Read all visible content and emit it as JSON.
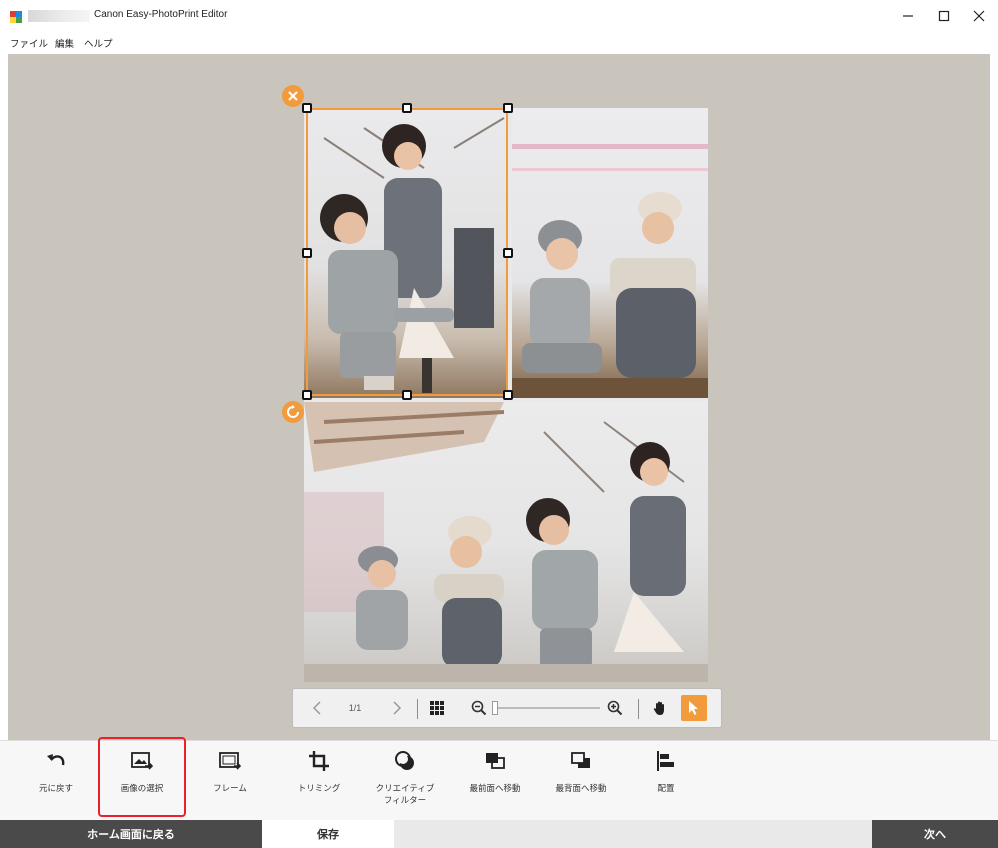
{
  "window": {
    "title": "Canon Easy-PhotoPrint Editor",
    "controls": {
      "minimize": "minimize-icon",
      "maximize": "maximize-icon",
      "close": "close-icon"
    }
  },
  "menu": [
    {
      "label": "ファイル"
    },
    {
      "label": "編集"
    },
    {
      "label": "ヘルプ"
    }
  ],
  "page_nav": {
    "page_indicator": "1/1"
  },
  "toolbar": [
    {
      "label": "元に戻す",
      "icon": "undo-icon"
    },
    {
      "label": "画像の選択",
      "icon": "select-image-icon"
    },
    {
      "label": "フレーム",
      "icon": "frame-icon"
    },
    {
      "label": "トリミング",
      "icon": "crop-icon"
    },
    {
      "label": "クリエイティブ\nフィルター",
      "icon": "creative-filter-icon"
    },
    {
      "label": "最前面へ移動",
      "icon": "bring-to-front-icon"
    },
    {
      "label": "最背面へ移動",
      "icon": "send-to-back-icon"
    },
    {
      "label": "配置",
      "icon": "align-icon"
    }
  ],
  "bottom": {
    "back_home": "ホーム画面に戻る",
    "save": "保存",
    "next": "次へ"
  },
  "colors": {
    "accent": "#f29b3c",
    "highlight": "#e8212a",
    "dark_button": "#4a4a4a",
    "workspace": "#c9c5bd"
  }
}
